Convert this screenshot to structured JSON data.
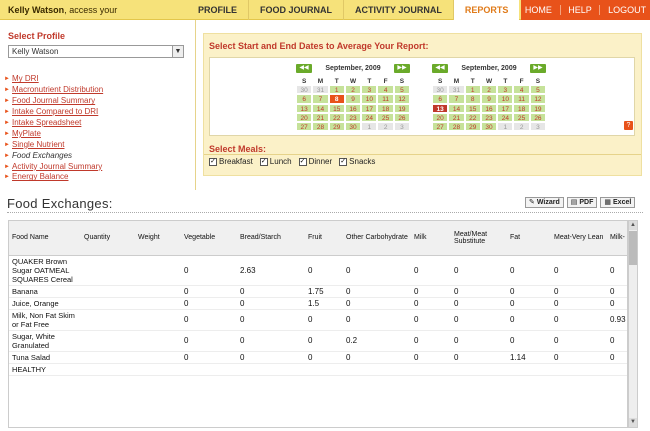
{
  "header": {
    "user_name": "Kelly Watson",
    "greeting_suffix": ", access your",
    "tabs": [
      {
        "label": "PROFILE"
      },
      {
        "label": "FOOD JOURNAL"
      },
      {
        "label": "ACTIVITY JOURNAL"
      },
      {
        "label": "REPORTS"
      }
    ],
    "right_links": [
      {
        "label": "HOME"
      },
      {
        "label": "HELP"
      },
      {
        "label": "LOGOUT"
      }
    ]
  },
  "sidebar": {
    "select_profile_label": "Select Profile",
    "profile_value": "Kelly Watson",
    "menu": [
      {
        "label": "My DRI"
      },
      {
        "label": "Macronutrient Distribution"
      },
      {
        "label": "Food Journal Summary"
      },
      {
        "label": "Intake Compared to DRI"
      },
      {
        "label": "Intake Spreadsheet"
      },
      {
        "label": "MyPlate"
      },
      {
        "label": "Single Nutrient"
      },
      {
        "label": "Food Exchanges"
      },
      {
        "label": "Activity Journal Summary"
      },
      {
        "label": "Energy Balance"
      }
    ],
    "current_index": 7
  },
  "dates": {
    "title": "Select Start and End Dates to Average Your Report:",
    "day_names": [
      "S",
      "M",
      "T",
      "W",
      "T",
      "F",
      "S"
    ],
    "calendars": [
      {
        "month": "September, 2009",
        "weeks": [
          [
            "30",
            "31",
            "1",
            "2",
            "3",
            "4",
            "5"
          ],
          [
            "6",
            "7",
            "8",
            "9",
            "10",
            "11",
            "12"
          ],
          [
            "13",
            "14",
            "15",
            "16",
            "17",
            "18",
            "19"
          ],
          [
            "20",
            "21",
            "22",
            "23",
            "24",
            "25",
            "26"
          ],
          [
            "27",
            "28",
            "29",
            "30",
            "1",
            "2",
            "3"
          ]
        ]
      },
      {
        "month": "September, 2009",
        "weeks": [
          [
            "30",
            "31",
            "1",
            "2",
            "3",
            "4",
            "5"
          ],
          [
            "6",
            "7",
            "8",
            "9",
            "10",
            "11",
            "12"
          ],
          [
            "13",
            "14",
            "15",
            "16",
            "17",
            "18",
            "19"
          ],
          [
            "20",
            "21",
            "22",
            "23",
            "24",
            "25",
            "26"
          ],
          [
            "27",
            "28",
            "29",
            "30",
            "1",
            "2",
            "3"
          ]
        ]
      }
    ],
    "help_label": "?"
  },
  "meals": {
    "title": "Select Meals:",
    "options": [
      {
        "label": "Breakfast",
        "checked": true
      },
      {
        "label": "Lunch",
        "checked": true
      },
      {
        "label": "Dinner",
        "checked": true
      },
      {
        "label": "Snacks",
        "checked": true
      }
    ]
  },
  "report": {
    "title": "Food Exchanges:",
    "buttons": [
      {
        "label": "Wizard"
      },
      {
        "label": "PDF"
      },
      {
        "label": "Excel"
      }
    ],
    "columns": [
      "Food Name",
      "Quantity",
      "Weight",
      "Vegetable",
      "Bread/Starch",
      "Fruit",
      "Other Carbohydrate",
      "Milk",
      "Meat/Meat Substitute",
      "Fat",
      "Meat-Very Lean",
      "Milk-"
    ],
    "rows": [
      [
        "QUAKER Brown Sugar OATMEAL SQUARES Cereal",
        "",
        "",
        "0",
        "2.63",
        "0",
        "0",
        "0",
        "0",
        "0",
        "0",
        "0"
      ],
      [
        "Banana",
        "",
        "",
        "0",
        "0",
        "1.75",
        "0",
        "0",
        "0",
        "0",
        "0",
        "0"
      ],
      [
        "Juice, Orange",
        "",
        "",
        "0",
        "0",
        "1.5",
        "0",
        "0",
        "0",
        "0",
        "0",
        "0"
      ],
      [
        "Milk, Non Fat Skim or Fat Free",
        "",
        "",
        "0",
        "0",
        "0",
        "0",
        "0",
        "0",
        "0",
        "0",
        "0.93"
      ],
      [
        "Sugar, White Granulated",
        "",
        "",
        "0",
        "0",
        "0",
        "0.2",
        "0",
        "0",
        "0",
        "0",
        "0"
      ],
      [
        "Tuna Salad",
        "",
        "",
        "0",
        "0",
        "0",
        "0",
        "0",
        "0",
        "1.14",
        "0",
        "0"
      ],
      [
        "HEALTHY",
        "",
        "",
        "",
        "",
        "",
        "",
        "",
        "",
        "",
        "",
        ""
      ]
    ]
  },
  "colors": {
    "topbar": "#f6e27a",
    "accent_orange": "#e8521a",
    "link_red": "#c0392b",
    "calendar_green": "#c6e29a",
    "panel_bg": "#fbf1c8"
  }
}
